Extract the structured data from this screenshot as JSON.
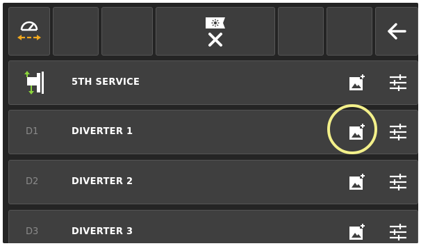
{
  "toolbar": {
    "buttons": [
      {
        "name": "speed-flow-button",
        "icon": "gauge-flow-icon"
      },
      {
        "name": "toolbar-slot-2",
        "icon": ""
      },
      {
        "name": "toolbar-slot-3",
        "icon": ""
      },
      {
        "name": "work-light-off-button",
        "icon": "light-off-icon"
      },
      {
        "name": "toolbar-slot-5",
        "icon": ""
      },
      {
        "name": "toolbar-slot-6",
        "icon": ""
      },
      {
        "name": "back-button",
        "icon": "arrow-left-icon"
      }
    ],
    "accent_color": "#f0a81e"
  },
  "rows": [
    {
      "code": "",
      "label": "5TH SERVICE",
      "lead_icon": "hydraulic-valve-icon",
      "accent_color": "#8bd43b"
    },
    {
      "code": "D1",
      "label": "DIVERTER 1"
    },
    {
      "code": "D2",
      "label": "DIVERTER 2"
    },
    {
      "code": "D3",
      "label": "DIVERTER 3"
    }
  ],
  "row_actions": {
    "image_icon": "add-image-icon",
    "settings_icon": "sliders-icon"
  },
  "highlight_color": "#f3f08a"
}
